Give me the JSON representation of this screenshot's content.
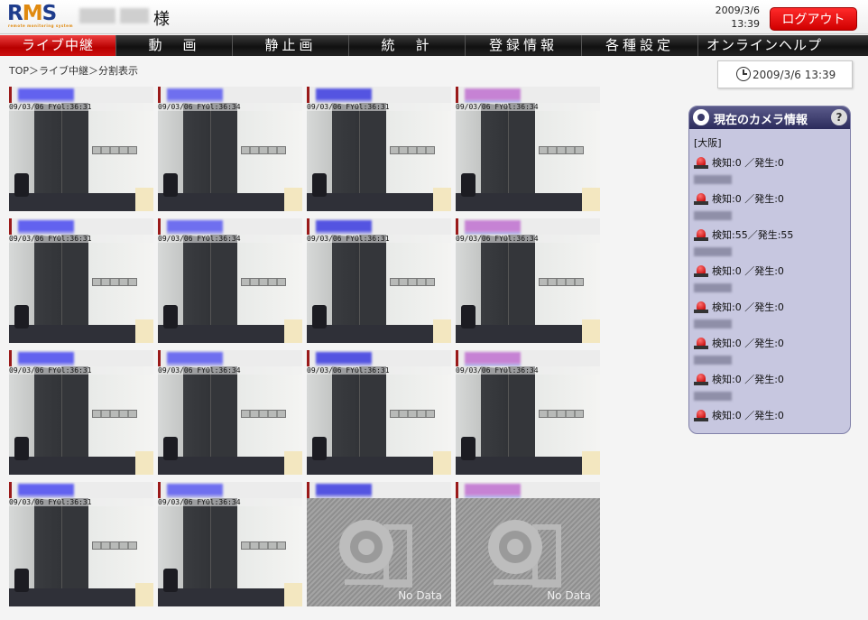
{
  "header": {
    "user_suffix": "様",
    "date": "2009/3/6",
    "time": "13:39",
    "logout_label": "ログアウト"
  },
  "logo": {
    "r": "R",
    "m": "M",
    "s": "S",
    "tagline": "remote monitoring system"
  },
  "nav": [
    {
      "label": "ライブ中継",
      "active": true
    },
    {
      "label": "動　画"
    },
    {
      "label": "静止画"
    },
    {
      "label": "統　計"
    },
    {
      "label": "登録情報"
    },
    {
      "label": "各種設定"
    },
    {
      "label": "オンラインヘルプ"
    }
  ],
  "breadcrumb": "TOP＞ライブ中継＞分割表示",
  "clock": "2009/3/6 13:39",
  "cameras": [
    {
      "ts": "09/03/06 FYOl:36:31",
      "color": "#4a4af0",
      "status": "live"
    },
    {
      "ts": "09/03/06 FYOl:36:34",
      "color": "#5a5af0",
      "status": "live"
    },
    {
      "ts": "09/03/06 FYOl:36:31",
      "color": "#3a3ae0",
      "status": "live"
    },
    {
      "ts": "09/03/06 FYOl:36:34",
      "color": "#c070d0",
      "status": "live"
    },
    {
      "ts": "09/03/06 FYOl:36:31",
      "color": "#4a4af0",
      "status": "live"
    },
    {
      "ts": "09/03/06 FYOl:36:34",
      "color": "#5a5af0",
      "status": "live"
    },
    {
      "ts": "09/03/06 FYOl:36:31",
      "color": "#3a3ae0",
      "status": "live"
    },
    {
      "ts": "09/03/06 FYOl:36:34",
      "color": "#c070d0",
      "status": "live"
    },
    {
      "ts": "09/03/06 FYOl:36:31",
      "color": "#4a4af0",
      "status": "live"
    },
    {
      "ts": "09/03/06 FYOl:36:34",
      "color": "#5a5af0",
      "status": "live"
    },
    {
      "ts": "09/03/06 FYOl:36:31",
      "color": "#3a3ae0",
      "status": "live"
    },
    {
      "ts": "09/03/06 FYOl:36:34",
      "color": "#c070d0",
      "status": "live"
    },
    {
      "ts": "09/03/06 FYOl:36:31",
      "color": "#4a4af0",
      "status": "live"
    },
    {
      "ts": "09/03/06 FYOl:36:34",
      "color": "#5a5af0",
      "status": "live"
    },
    {
      "ts": "",
      "color": "#3a3ae0",
      "status": "nodata",
      "nodata_label": "No Data"
    },
    {
      "ts": "",
      "color": "#c070d0",
      "status": "nodata",
      "nodata_label": "No Data"
    }
  ],
  "panel": {
    "title": "現在のカメラ情報",
    "help": "?",
    "region": "[大阪]",
    "rows": [
      {
        "text": "検知:0 ／発生:0"
      },
      {
        "text": "検知:0 ／発生:0"
      },
      {
        "text": "検知:55／発生:55"
      },
      {
        "text": "検知:0 ／発生:0"
      },
      {
        "text": "検知:0 ／発生:0"
      },
      {
        "text": "検知:0 ／発生:0"
      },
      {
        "text": "検知:0 ／発生:0"
      },
      {
        "text": "検知:0 ／発生:0"
      }
    ]
  }
}
